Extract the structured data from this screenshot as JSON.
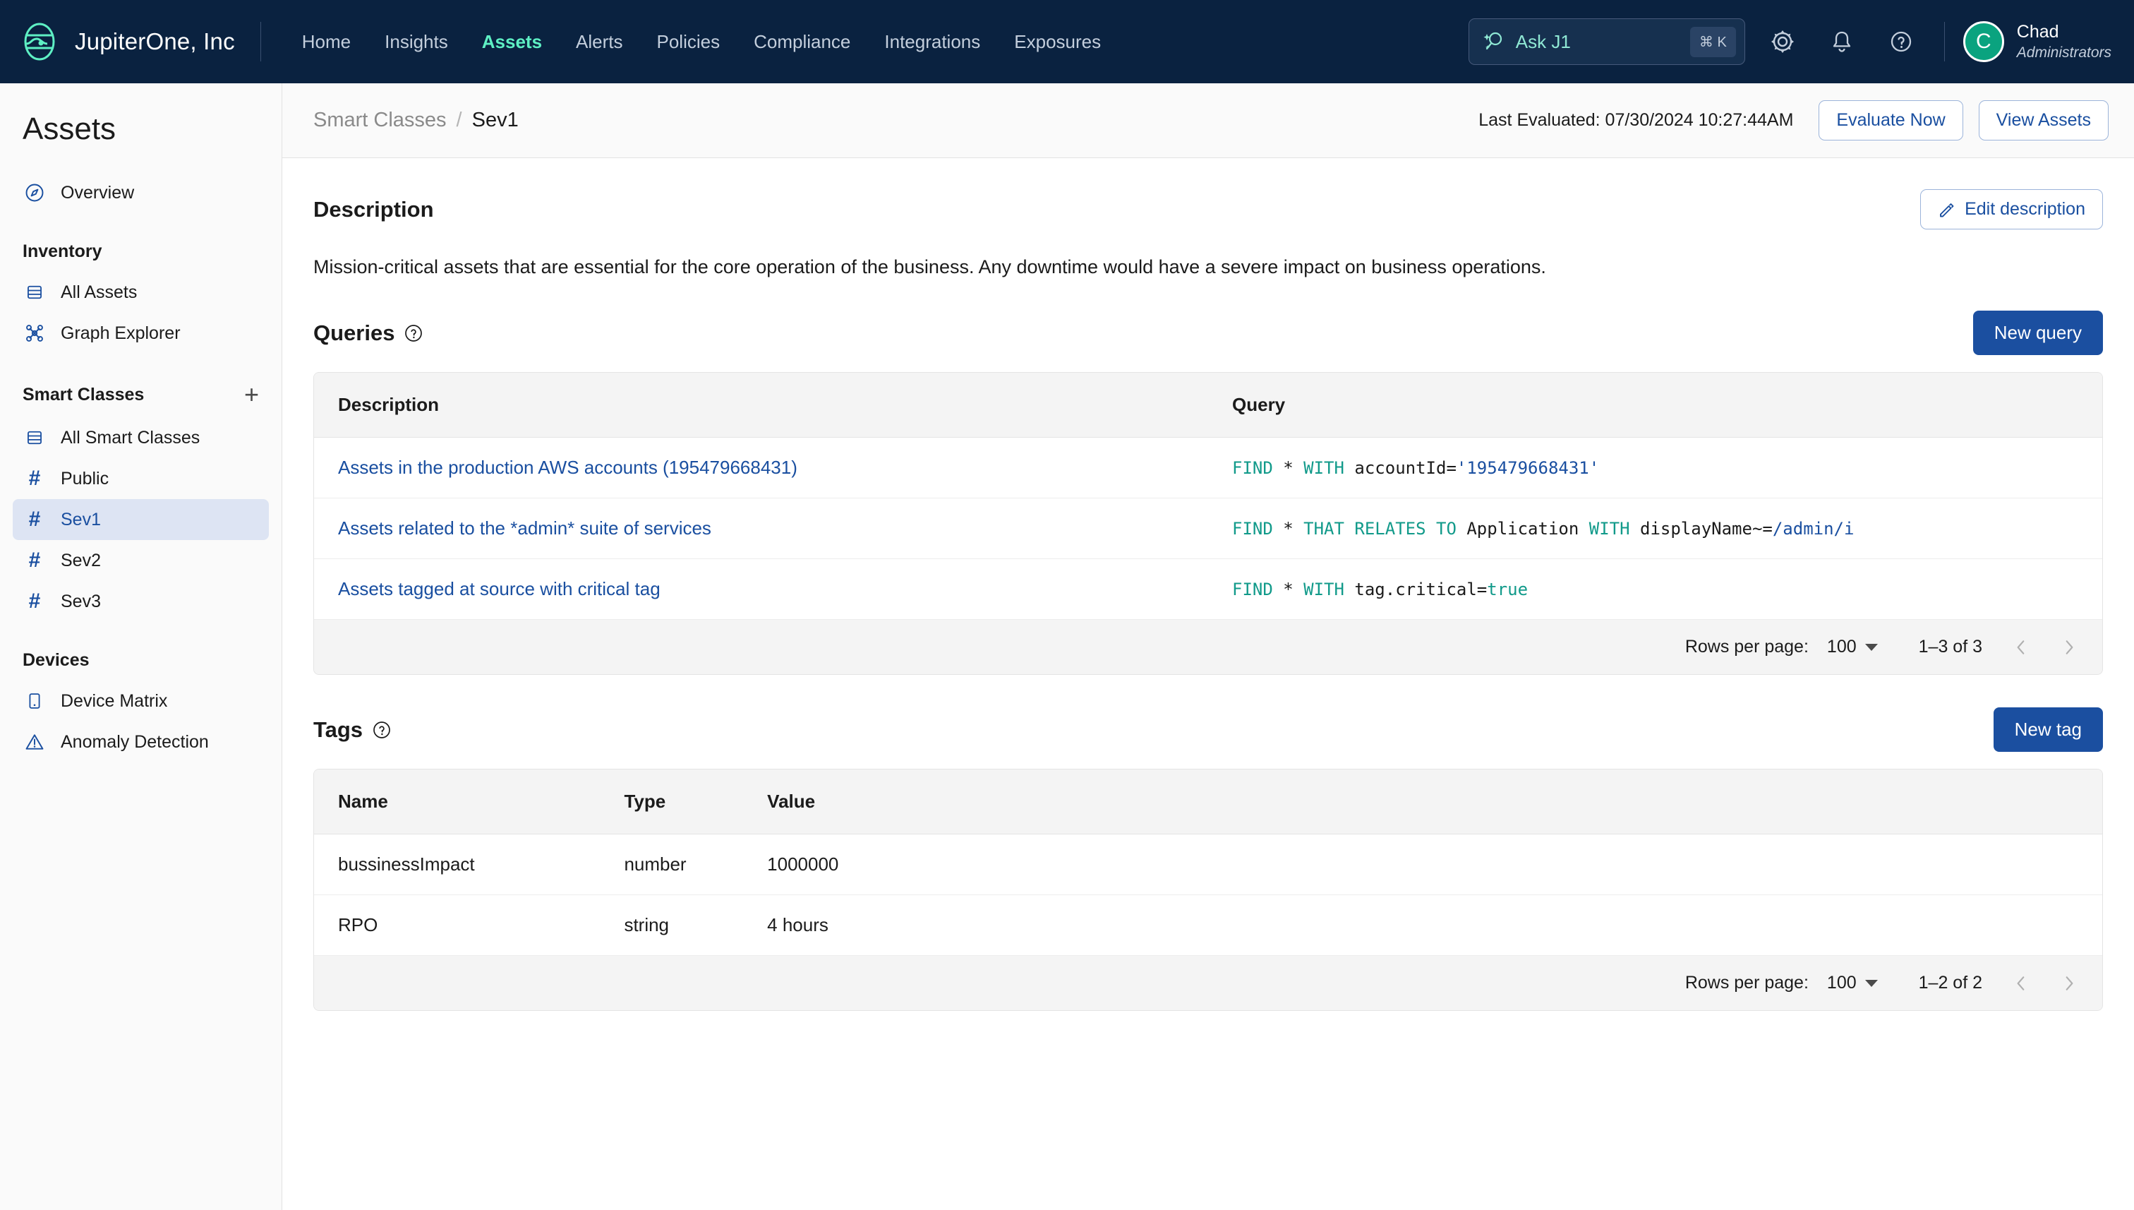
{
  "topnav": {
    "brand": "JupiterOne, Inc",
    "logo_icon": "jupiterone-logo-icon",
    "links": [
      {
        "label": "Home",
        "active": false
      },
      {
        "label": "Insights",
        "active": false
      },
      {
        "label": "Assets",
        "active": true
      },
      {
        "label": "Alerts",
        "active": false
      },
      {
        "label": "Policies",
        "active": false
      },
      {
        "label": "Compliance",
        "active": false
      },
      {
        "label": "Integrations",
        "active": false
      },
      {
        "label": "Exposures",
        "active": false
      }
    ],
    "search": {
      "placeholder": "Ask J1",
      "icon": "ai-search-icon",
      "shortcut": "⌘ K"
    },
    "icons": [
      "gear-icon",
      "bell-icon",
      "help-circle-icon"
    ],
    "user": {
      "initial": "C",
      "name": "Chad",
      "role": "Administrators"
    }
  },
  "sidebar": {
    "title": "Assets",
    "overview": {
      "label": "Overview",
      "icon": "compass-icon"
    },
    "groups": [
      {
        "label": "Inventory",
        "add": false,
        "items": [
          {
            "label": "All Assets",
            "icon": "table-icon",
            "active": false
          },
          {
            "label": "Graph Explorer",
            "icon": "graph-icon",
            "active": false
          }
        ]
      },
      {
        "label": "Smart Classes",
        "add": true,
        "add_label": "+",
        "items": [
          {
            "label": "All Smart Classes",
            "icon": "table-icon",
            "active": false
          },
          {
            "label": "Public",
            "icon": "hash-icon",
            "active": false
          },
          {
            "label": "Sev1",
            "icon": "hash-icon",
            "active": true
          },
          {
            "label": "Sev2",
            "icon": "hash-icon",
            "active": false
          },
          {
            "label": "Sev3",
            "icon": "hash-icon",
            "active": false
          }
        ]
      },
      {
        "label": "Devices",
        "add": false,
        "items": [
          {
            "label": "Device Matrix",
            "icon": "device-icon",
            "active": false
          },
          {
            "label": "Anomaly Detection",
            "icon": "warning-triangle-icon",
            "active": false
          }
        ]
      }
    ]
  },
  "breadcrumb": {
    "parent": "Smart Classes",
    "separator": "/",
    "current": "Sev1"
  },
  "header_actions": {
    "last_evaluated": "Last Evaluated: 07/30/2024 10:27:44AM",
    "evaluate_now": "Evaluate Now",
    "view_assets": "View Assets"
  },
  "description": {
    "title": "Description",
    "edit_label": "Edit description",
    "edit_icon": "pencil-icon",
    "text": "Mission-critical assets that are essential for the core operation of the business. Any downtime would have a severe impact on business operations."
  },
  "queries": {
    "title": "Queries",
    "help_icon": "help-circle-icon",
    "new_label": "New query",
    "columns": [
      "Description",
      "Query"
    ],
    "rows": [
      {
        "description": "Assets in the production AWS accounts (195479668431)",
        "query_tokens": [
          {
            "t": "FIND",
            "c": "kw"
          },
          {
            "t": " * ",
            "c": ""
          },
          {
            "t": "WITH",
            "c": "kw"
          },
          {
            "t": " accountId=",
            "c": ""
          },
          {
            "t": "'195479668431'",
            "c": "str"
          }
        ]
      },
      {
        "description": "Assets related to the *admin* suite of services",
        "query_tokens": [
          {
            "t": "FIND",
            "c": "kw"
          },
          {
            "t": " * ",
            "c": ""
          },
          {
            "t": "THAT RELATES TO",
            "c": "kw"
          },
          {
            "t": " Application ",
            "c": ""
          },
          {
            "t": "WITH",
            "c": "kw"
          },
          {
            "t": " displayName~=",
            "c": ""
          },
          {
            "t": "/admin/i",
            "c": "str"
          }
        ]
      },
      {
        "description": "Assets tagged at source with critical tag",
        "query_tokens": [
          {
            "t": "FIND",
            "c": "kw"
          },
          {
            "t": " * ",
            "c": ""
          },
          {
            "t": "WITH",
            "c": "kw"
          },
          {
            "t": " tag.critical=",
            "c": ""
          },
          {
            "t": "true",
            "c": "tf"
          }
        ]
      }
    ],
    "footer": {
      "rows_per_page_label": "Rows per page:",
      "rows_per_page_value": "100",
      "range": "1–3 of 3",
      "prev_icon": "chevron-left-icon",
      "next_icon": "chevron-right-icon"
    }
  },
  "tags": {
    "title": "Tags",
    "help_icon": "help-circle-icon",
    "new_label": "New tag",
    "columns": [
      "Name",
      "Type",
      "Value"
    ],
    "rows": [
      {
        "name": "bussinessImpact",
        "type": "number",
        "value": "1000000"
      },
      {
        "name": "RPO",
        "type": "string",
        "value": "4 hours"
      }
    ],
    "footer": {
      "rows_per_page_label": "Rows per page:",
      "rows_per_page_value": "100",
      "range": "1–2 of 2",
      "prev_icon": "chevron-left-icon",
      "next_icon": "chevron-right-icon"
    }
  },
  "colors": {
    "nav_bg": "#0a2240",
    "accent_teal": "#5ef0c4",
    "primary_blue": "#1b4fa0",
    "link_blue": "#1a4fa0",
    "avatar_green": "#0aa37f",
    "code_keyword": "#119a8a",
    "code_string": "#1a4fa0"
  }
}
